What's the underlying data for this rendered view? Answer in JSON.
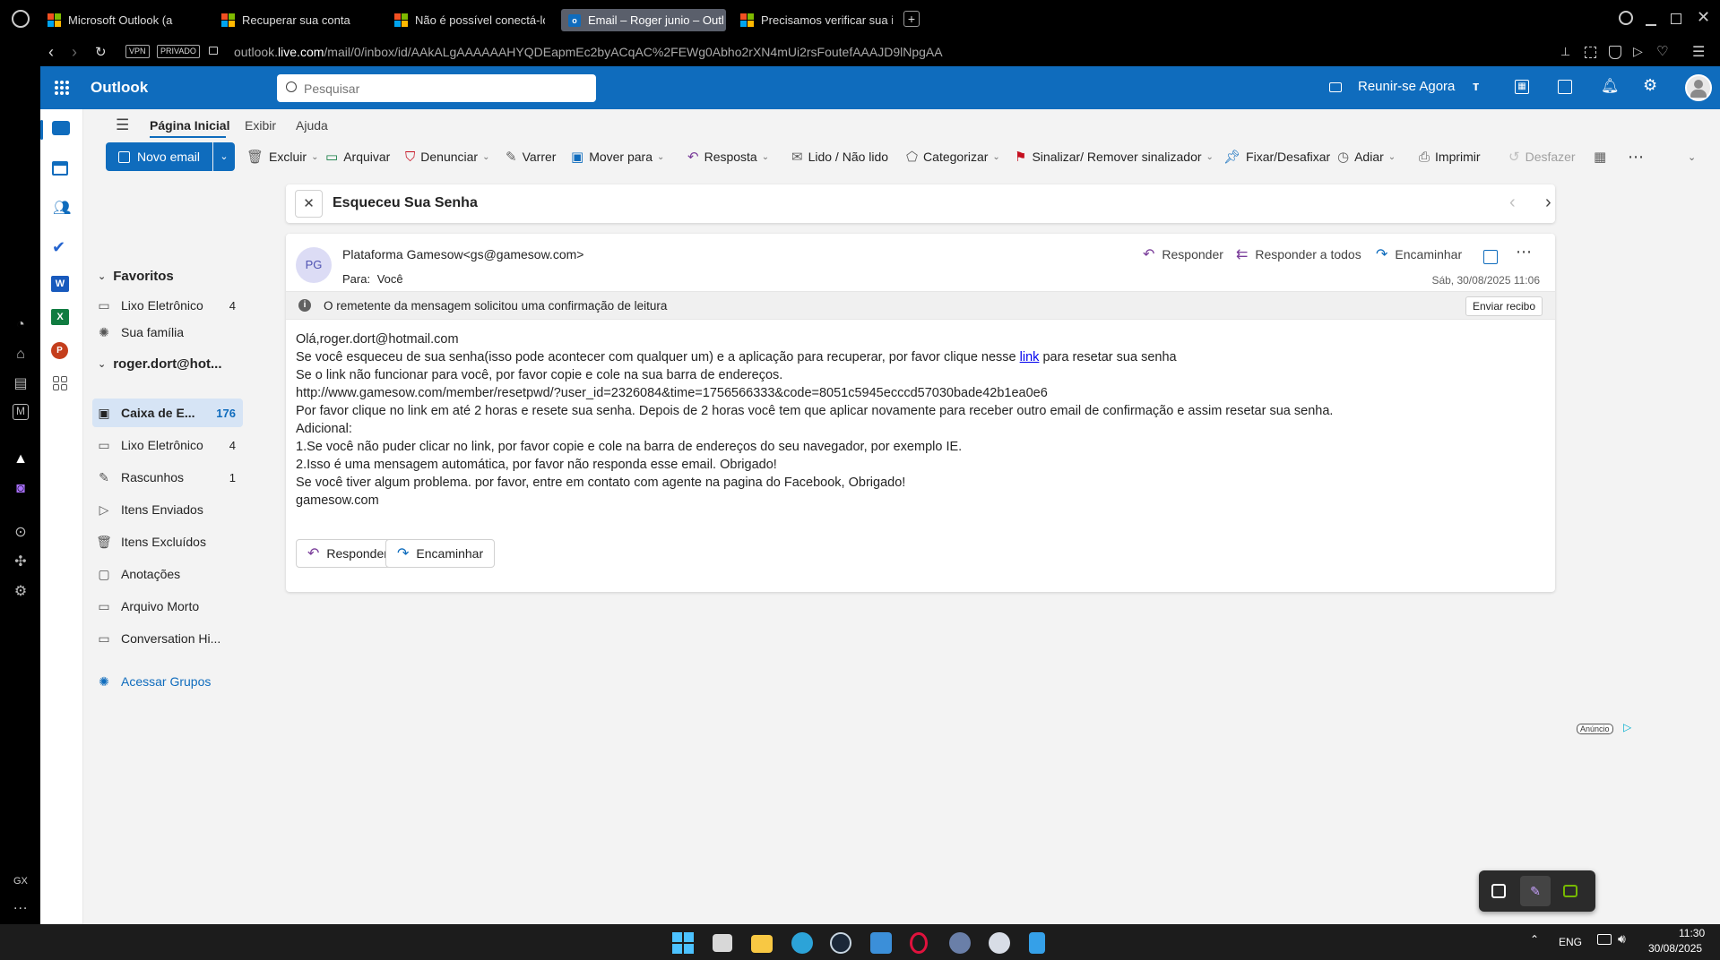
{
  "browser": {
    "tabs": [
      {
        "label": "Microsoft Outlook (anterio"
      },
      {
        "label": "Recuperar sua conta"
      },
      {
        "label": "Não é possível conectá-lo"
      },
      {
        "label": "Email – Roger junio – Outl"
      },
      {
        "label": "Precisamos verificar sua i"
      }
    ],
    "new_tab": "+",
    "vpn": "VPN",
    "private": "PRIVADO",
    "url_prefix": "outlook.",
    "url_host": "live.com",
    "url_path": "/mail/0/inbox/id/AAkALgAAAAAAHYQDEapmEc2byACqAC%2FEWg0Abho2rXN4mUi2rsFoutefAAAJD9lNpgAA",
    "gx_label": "GX",
    "more": "..."
  },
  "header": {
    "app_name": "Outlook",
    "search_placeholder": "Pesquisar",
    "meet_now": "Reunir-se Agora"
  },
  "ribbon": {
    "tabs": [
      "Página Inicial",
      "Exibir",
      "Ajuda"
    ],
    "new_email": "Novo email",
    "buttons": {
      "delete": "Excluir",
      "archive": "Arquivar",
      "report": "Denunciar",
      "sweep": "Varrer",
      "move": "Mover para",
      "reply": "Resposta",
      "read_unread": "Lido / Não lido",
      "categorize": "Categorizar",
      "flag": "Sinalizar/ Remover sinalizador",
      "pin": "Fixar/Desafixar",
      "snooze": "Adiar",
      "print": "Imprimir",
      "undo": "Desfazer"
    }
  },
  "folders": {
    "favorites_title": "Favoritos",
    "favorites": [
      {
        "label": "Lixo Eletrônico",
        "count": "4"
      },
      {
        "label": "Sua família",
        "count": ""
      }
    ],
    "account": "roger.dort@hot...",
    "items": [
      {
        "label": "Caixa de E...",
        "count": "176"
      },
      {
        "label": "Lixo Eletrônico",
        "count": "4"
      },
      {
        "label": "Rascunhos",
        "count": "1"
      },
      {
        "label": "Itens Enviados",
        "count": ""
      },
      {
        "label": "Itens Excluídos",
        "count": ""
      },
      {
        "label": "Anotações",
        "count": ""
      },
      {
        "label": "Arquivo Morto",
        "count": ""
      },
      {
        "label": "Conversation Hi...",
        "count": ""
      }
    ],
    "groups": "Acessar Grupos"
  },
  "message": {
    "subject": "Esqueceu Sua Senha",
    "avatar_initials": "PG",
    "sender": "Plataforma Gamesow<gs@gamesow.com>",
    "to_label": "Para:",
    "to_value": "Você",
    "date": "Sáb, 30/08/2025 11:06",
    "actions": {
      "reply": "Responder",
      "reply_all": "Responder a todos",
      "forward": "Encaminhar"
    },
    "receipt_notice": "O remetente da mensagem solicitou uma confirmação de leitura",
    "send_receipt": "Enviar recibo",
    "body": {
      "l1": "Olá,roger.dort@hotmail.com",
      "l2a": "Se você esqueceu de sua senha(isso pode acontecer com qualquer um) e a aplicação para recuperar, por favor clique nesse ",
      "l2link": "link",
      "l2b": " para resetar sua senha",
      "l3": "Se o link não funcionar para você, por favor copie e cole na sua barra de endereços.",
      "l4": "http://www.gamesow.com/member/resetpwd/?user_id=2326084&time=1756566333&code=8051c5945ecccd57030bade42b1ea0e6",
      "l5": "Por favor clique no link em até 2 horas e resete sua senha. Depois de 2 horas você tem que aplicar novamente para receber outro email de confirmação e assim resetar sua senha.",
      "l6": "Adicional:",
      "l7": "1.Se você não puder clicar no link, por favor copie e cole na barra de endereços do seu navegador, por exemplo IE.",
      "l8": "2.Isso é uma mensagem automática, por favor não responda esse email. Obrigado!",
      "l9": "Se você tiver algum problema. por favor, entre em contato com agente na pagina do Facebook, Obrigado!",
      "l10": "gamesow.com"
    },
    "bottom_reply": "Responder",
    "bottom_forward": "Encaminhar"
  },
  "ad_label": "Anúncio",
  "taskbar": {
    "lang": "ENG",
    "time": "11:30",
    "date": "30/08/2025"
  },
  "colors": {
    "outlook_blue": "#0f6cbd",
    "selected_folder": "#d6e4f5",
    "link": "#0000ee"
  }
}
